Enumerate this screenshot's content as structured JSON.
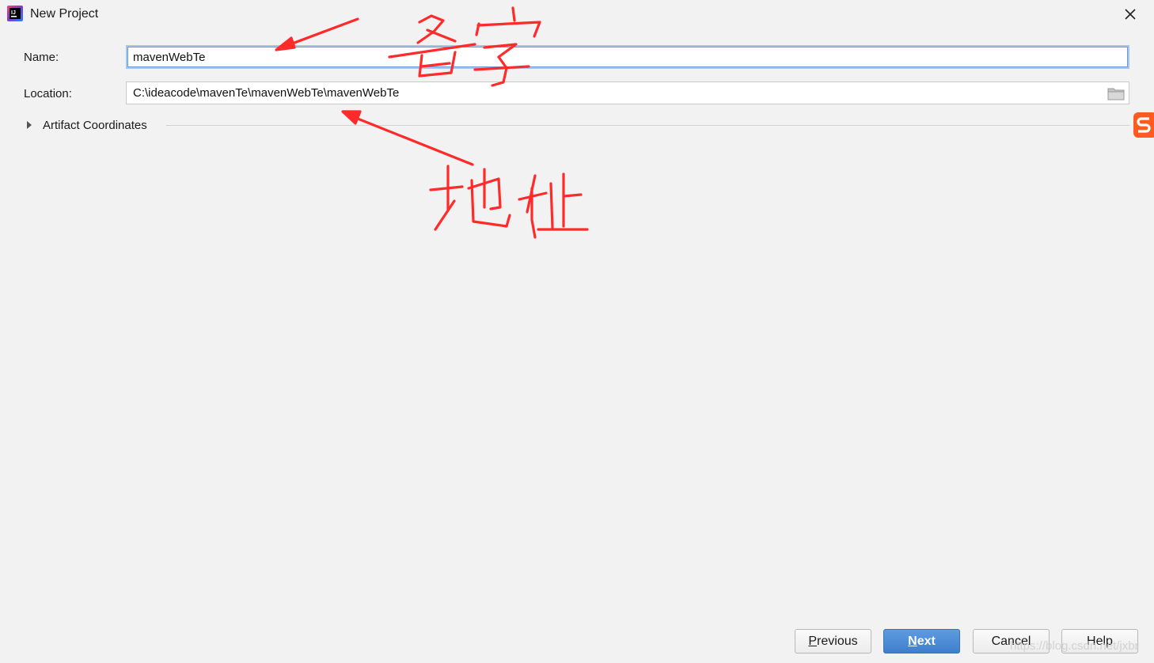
{
  "window": {
    "title": "New Project",
    "icon": "intellij-idea-icon",
    "close_icon": "close-icon"
  },
  "form": {
    "name_label": "Name:",
    "name_value": "mavenWebTe",
    "location_label": "Location:",
    "location_value": "C:\\ideacode\\mavenTe\\mavenWebTe\\mavenWebTe",
    "folder_icon": "folder-icon",
    "artifact_section_label": "Artifact Coordinates",
    "artifact_collapsed": true
  },
  "buttons": {
    "previous": {
      "mnemonic": "P",
      "rest": "revious"
    },
    "next": {
      "mnemonic": "N",
      "rest": "ext"
    },
    "cancel": "Cancel",
    "help": "Help"
  },
  "annotations": {
    "name_note": "名字",
    "location_note": "地址",
    "color": "#ff2020"
  },
  "overlay": {
    "watermark": "https://blog.csdn.net/jxbr",
    "ime_icon": "sogou-ime-icon"
  },
  "colors": {
    "background": "#f2f2f2",
    "primary_button": "#4a8bd6",
    "focus_border": "#6b9bd6"
  }
}
